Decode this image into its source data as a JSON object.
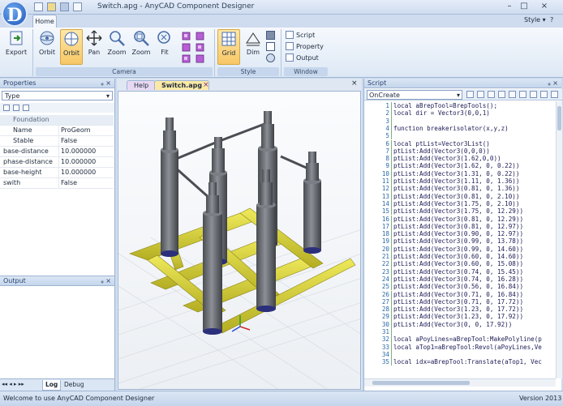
{
  "window": {
    "title": "Switch.apg - AnyCAD Component Designer",
    "logo_letter": "D",
    "minimize": "–",
    "maximize": "□",
    "close": "×"
  },
  "ribbon": {
    "tabs": [
      "Home"
    ],
    "style_menu": "Style ▾",
    "buttons": {
      "export": "Export",
      "orbit1": "Orbit",
      "orbit2": "Orbit",
      "pan": "Pan",
      "zoom1": "Zoom",
      "zoom2": "Zoom",
      "fit": "Fit",
      "grid": "Grid",
      "dim": "Dim",
      "script": "Script",
      "property": "Property",
      "output": "Output"
    },
    "groups": {
      "camera": "Camera",
      "style": "Style",
      "window": "Window"
    }
  },
  "properties": {
    "title": "Properties",
    "pin": "ᵩ ×",
    "type_select": "Type",
    "rows": [
      {
        "key": "Foundation",
        "value": "",
        "kind": "category"
      },
      {
        "key": "Name",
        "value": "ProGeom",
        "kind": "indent"
      },
      {
        "key": "Stable",
        "value": "False",
        "kind": "indent"
      },
      {
        "key": "base-distance",
        "value": "10.000000",
        "kind": "plain"
      },
      {
        "key": "phase-distance",
        "value": "10.000000",
        "kind": "plain"
      },
      {
        "key": "base-height",
        "value": "10.000000",
        "kind": "plain"
      },
      {
        "key": "swith",
        "value": "False",
        "kind": "plain"
      }
    ]
  },
  "output": {
    "title": "Output",
    "pin": "ᵩ ×",
    "nav": "◂◂ ◂ ▸ ▸▸",
    "tabs": [
      "Log",
      "Debug"
    ]
  },
  "documents": {
    "tabs": [
      "Help",
      "Switch.apg"
    ],
    "close": "×"
  },
  "script": {
    "title": "Script",
    "pin": "ᵩ ×",
    "event": "OnCreate",
    "lines": [
      "local aBrepTool=BrepTools();",
      "local dir = Vector3(0,0,1)",
      "",
      "function breakerisolator(x,y,z)",
      "",
      "local ptList=Vector3List()",
      "ptList:Add(Vector3(0,0,0))",
      "ptList:Add(Vector3(1.62,0,0))",
      "ptList:Add(Vector3(1.62, 0, 0.22))",
      "ptList:Add(Vector3(1.31, 0, 0.22))",
      "ptList:Add(Vector3(1.11, 0, 1.36))",
      "ptList:Add(Vector3(0.81, 0, 1.36))",
      "ptList:Add(Vector3(0.81, 0, 2.10))",
      "ptList:Add(Vector3(1.75, 0, 2.10))",
      "ptList:Add(Vector3(1.75, 0, 12.29))",
      "ptList:Add(Vector3(0.81, 0, 12.29))",
      "ptList:Add(Vector3(0.81, 0, 12.97))",
      "ptList:Add(Vector3(0.90, 0, 12.97))",
      "ptList:Add(Vector3(0.99, 0, 13.78))",
      "ptList:Add(Vector3(0.99, 0, 14.60))",
      "ptList:Add(Vector3(0.60, 0, 14.60))",
      "ptList:Add(Vector3(0.60, 0, 15.08))",
      "ptList:Add(Vector3(0.74, 0, 15.45))",
      "ptList:Add(Vector3(0.74, 0, 16.28))",
      "ptList:Add(Vector3(0.56, 0, 16.84))",
      "ptList:Add(Vector3(0.71, 0, 16.84))",
      "ptList:Add(Vector3(0.71, 0, 17.72))",
      "ptList:Add(Vector3(1.23, 0, 17.72))",
      "ptList:Add(Vector3(1.23, 0, 17.92))",
      "ptList:Add(Vector3(0, 0, 17.92))",
      "",
      "local aPoyLines=aBrepTool:MakePolyline(p",
      "local aTop1=aBrepTool:Revol(aPoyLines,Ve",
      "",
      "local idx=aBrepTool:Translate(aTop1, Vec"
    ]
  },
  "status": {
    "message": "Welcome to use AnyCAD Component Designer",
    "version": "Version 2013"
  },
  "colors": {
    "ribbon_bg": "#dde8f5",
    "accent": "#f7c766",
    "steel_base": "#d9d23a",
    "insulator": "#6b6e72",
    "code_keyword": "#1a1a55",
    "line_number": "#2a6aa8"
  }
}
